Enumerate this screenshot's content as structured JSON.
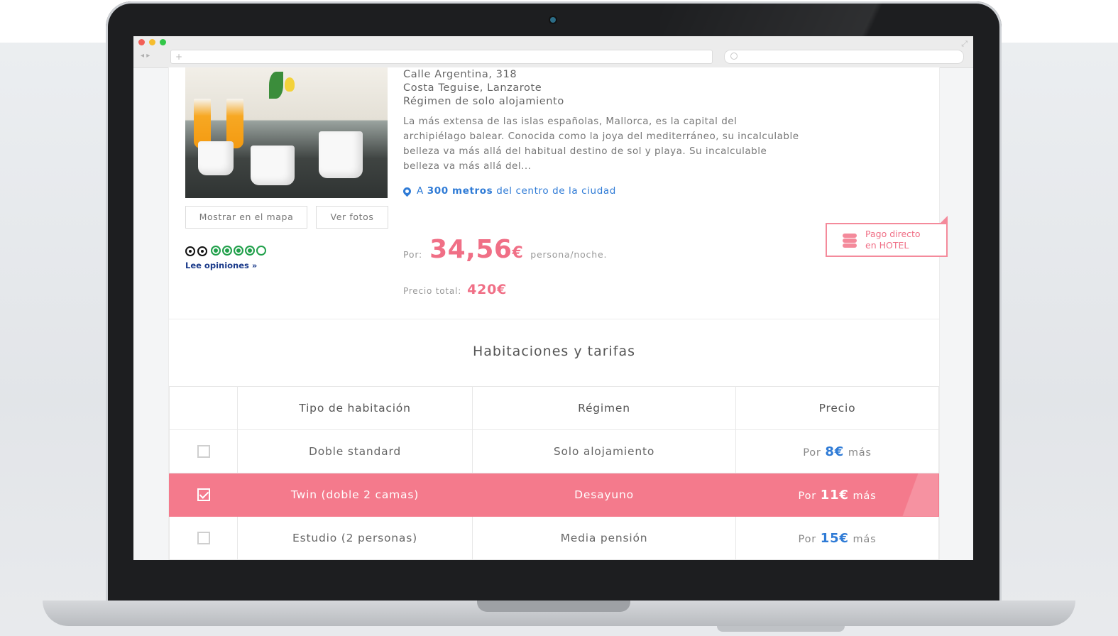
{
  "hotel": {
    "address_line1": "Calle Argentina, 318",
    "address_line2": "Costa Teguise, Lanzarote",
    "regime": "Régimen de solo alojamiento",
    "description": "La más extensa de las islas españolas, Mallorca, es la capital del archipiélago balear. Conocida como la joya del mediterráneo, su incalculable belleza va más allá del habitual destino de sol y playa. Su incalculable belleza va más allá del...",
    "distance_prefix": "A",
    "distance_value": "300 metros",
    "distance_suffix": "del centro de la ciudad",
    "buttons": {
      "map": "Mostrar en el mapa",
      "photos": "Ver fotos"
    },
    "reviews_link": "Lee opiniones »",
    "rating_bubbles": 5
  },
  "price": {
    "per_label": "Por:",
    "per_value": "34,56",
    "currency": "€",
    "per_unit": "persona/noche.",
    "total_label": "Precio total:",
    "total_value": "420€"
  },
  "payment_badge": {
    "line1": "Pago directo",
    "line2": "en HOTEL"
  },
  "rooms": {
    "title": "Habitaciones y tarifas",
    "headers": [
      "Tipo de habitación",
      "Régimen",
      "Precio"
    ],
    "rows": [
      {
        "type": "Doble standard",
        "regime": "Solo alojamiento",
        "price_pre": "Por",
        "price_amount": "8€",
        "price_post": "más",
        "selected": false
      },
      {
        "type": "Twin (doble 2 camas)",
        "regime": "Desayuno",
        "price_pre": "Por",
        "price_amount": "11€",
        "price_post": "más",
        "selected": true
      },
      {
        "type": "Estudio (2 personas)",
        "regime": "Media pensión",
        "price_pre": "Por",
        "price_amount": "15€",
        "price_post": "más",
        "selected": false
      }
    ]
  },
  "colors": {
    "accent_pink": "#f06f86",
    "selected_row": "#f47a8c",
    "link_blue": "#2f7bd6"
  }
}
